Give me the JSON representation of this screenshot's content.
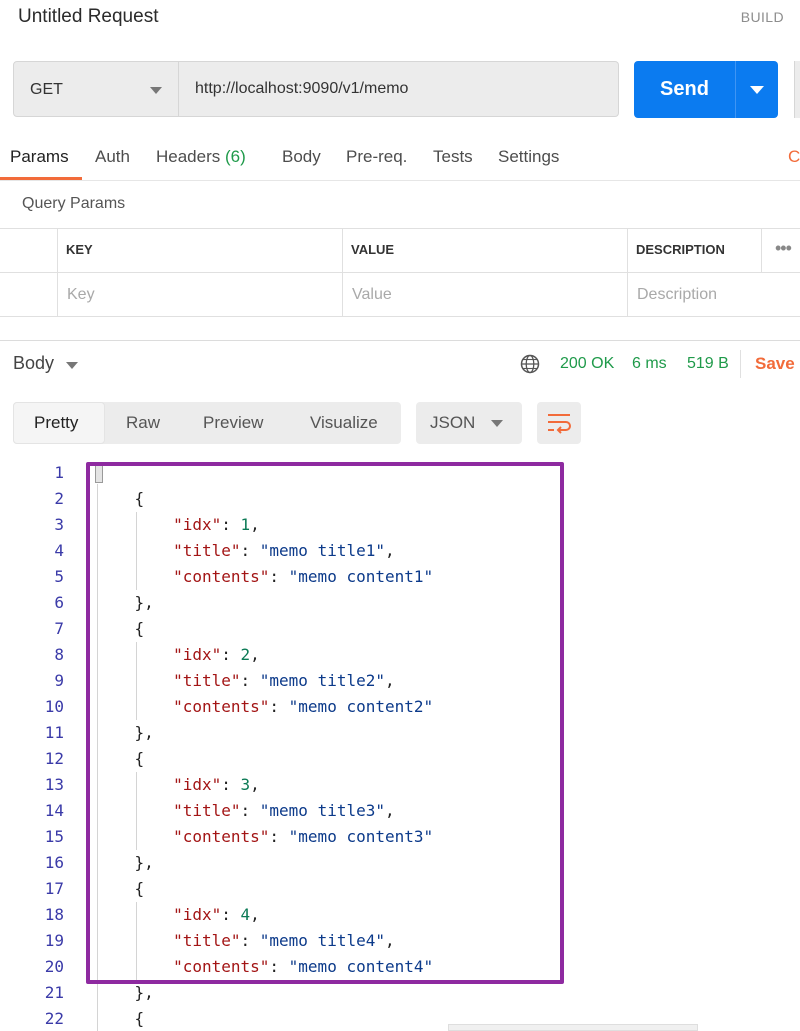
{
  "request": {
    "title": "Untitled Request",
    "build_label": "BUILD",
    "method": "GET",
    "url": "http://localhost:9090/v1/memo",
    "send_label": "Send"
  },
  "tabs": {
    "params": "Params",
    "auth": "Auth",
    "headers": "Headers",
    "headers_count": "(6)",
    "body": "Body",
    "prereq": "Pre-req.",
    "tests": "Tests",
    "settings": "Settings",
    "cookies_partial": "C"
  },
  "query_params": {
    "title": "Query Params",
    "columns": [
      "KEY",
      "VALUE",
      "DESCRIPTION"
    ],
    "placeholders": [
      "Key",
      "Value",
      "Description"
    ]
  },
  "response": {
    "body_label": "Body",
    "status": "200 OK",
    "time": "6 ms",
    "size": "519 B",
    "save_label": "Save",
    "views": [
      "Pretty",
      "Raw",
      "Preview",
      "Visualize"
    ],
    "active_view": "Pretty",
    "format": "JSON"
  },
  "editor": {
    "line_numbers": [
      "1",
      "2",
      "3",
      "4",
      "5",
      "6",
      "7",
      "8",
      "9",
      "10",
      "11",
      "12",
      "13",
      "14",
      "15",
      "16",
      "17",
      "18",
      "19",
      "20",
      "21",
      "22"
    ],
    "memos": [
      {
        "idx": "1",
        "title": "\"memo title1\"",
        "contents": "\"memo content1\""
      },
      {
        "idx": "2",
        "title": "\"memo title2\"",
        "contents": "\"memo content2\""
      },
      {
        "idx": "3",
        "title": "\"memo title3\"",
        "contents": "\"memo content3\""
      },
      {
        "idx": "4",
        "title": "\"memo title4\"",
        "contents": "\"memo content4\""
      }
    ],
    "keys": {
      "idx": "\"idx\"",
      "title": "\"title\"",
      "contents": "\"contents\""
    }
  },
  "colors": {
    "accent": "#f26b3a",
    "send": "#0b7bf0",
    "status_ok": "#1f9a4a",
    "highlight": "#8e2aa0"
  }
}
